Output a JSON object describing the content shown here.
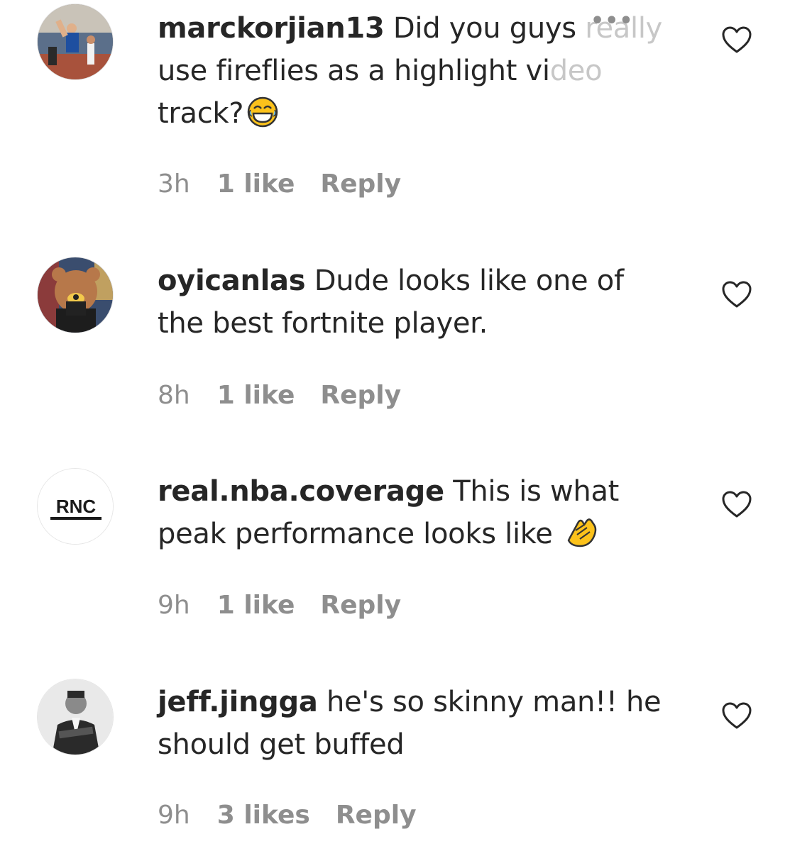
{
  "comments": [
    {
      "username": "marckorjian13",
      "text_visible": "Did you guys ",
      "text_faded_1": "really",
      "text_line2_a": "use fireflies as a highlight vi",
      "text_line2_faded": "deo",
      "text_line3": "track?",
      "more_label": "•••",
      "emoji": "tears-of-joy-emoji",
      "time": "3h",
      "likes": "1 like",
      "reply": "Reply"
    },
    {
      "username": "oyicanlas",
      "text": "Dude looks like one of the best fortnite player.",
      "time": "8h",
      "likes": "1 like",
      "reply": "Reply"
    },
    {
      "username": "real.nba.coverage",
      "text": "This is what peak performance looks like",
      "avatar_text": "RNC",
      "emoji": "clapping-hands-emoji",
      "time": "9h",
      "likes": "1 like",
      "reply": "Reply"
    },
    {
      "username": "jeff.jingga",
      "text": "he's so skinny man!! he should get buffed",
      "time": "9h",
      "likes": "3 likes",
      "reply": "Reply"
    }
  ],
  "colors": {
    "text": "#262626",
    "secondary": "#8e8e8e",
    "faded": "#c7c7c7",
    "emoji_yellow": "#fcc21b"
  }
}
